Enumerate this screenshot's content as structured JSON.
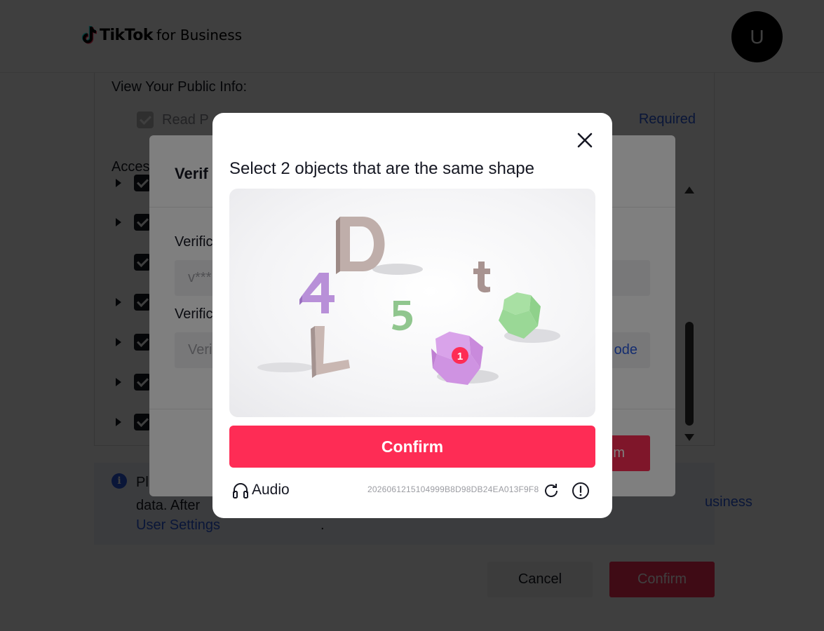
{
  "header": {
    "brand_name": "TikTok",
    "brand_suffix": "for Business",
    "avatar_initial": "U"
  },
  "permissions": {
    "public_info_heading": "View Your Public Info:",
    "read_profile_label": "Read P",
    "required_label": "Required",
    "access_heading": "Acces"
  },
  "notice": {
    "line1": "Pl",
    "line2": "data. After",
    "business_link_partial": "usiness",
    "settings_link": "User Settings",
    "period": "."
  },
  "footer": {
    "cancel_label": "Cancel",
    "confirm_label": "Confirm"
  },
  "verify_dialog": {
    "title_partial": "Verif",
    "field1_label_partial": "Verific",
    "field1_value_partial": "v***",
    "field2_label_partial": "Verific",
    "field2_placeholder_partial": "Veri",
    "send_code_partial": "ode",
    "confirm_partial": "m"
  },
  "captcha": {
    "title": "Select 2 objects that are the same shape",
    "confirm_label": "Confirm",
    "audio_label": "Audio",
    "challenge_id": "2026061215104999B8D98DB24EA013F9F8",
    "selection_marker": "1",
    "brand_color": "#fe2c55"
  }
}
